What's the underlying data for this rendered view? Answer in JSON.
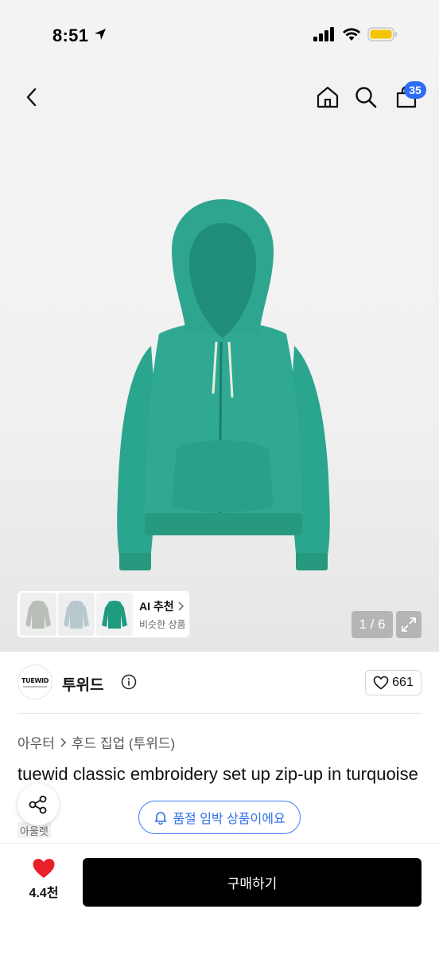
{
  "status": {
    "time": "8:51"
  },
  "nav": {
    "cart_count": "35"
  },
  "ai_reco": {
    "title": "AI 추천",
    "subtitle": "비슷한 상품"
  },
  "gallery": {
    "page_indicator": "1 / 6"
  },
  "brand": {
    "logo_text": "TUEWID",
    "name": "투위드",
    "like_count": "661"
  },
  "breadcrumb": {
    "category": "아우터",
    "subcategory": "후드 집업 (투위드)"
  },
  "product": {
    "title": "tuewid classic embroidery set up zip-up in turquoise",
    "tag": "아울렛"
  },
  "notice": {
    "soldout_label": "품절 임박 상품이에요"
  },
  "bottom": {
    "wish_count": "4.4천",
    "buy_label": "구매하기"
  },
  "colors": {
    "accent_blue": "#2d6cf5",
    "hoodie_teal": "#2fa992",
    "wish_red": "#e8202a",
    "buy_black": "#000000"
  }
}
